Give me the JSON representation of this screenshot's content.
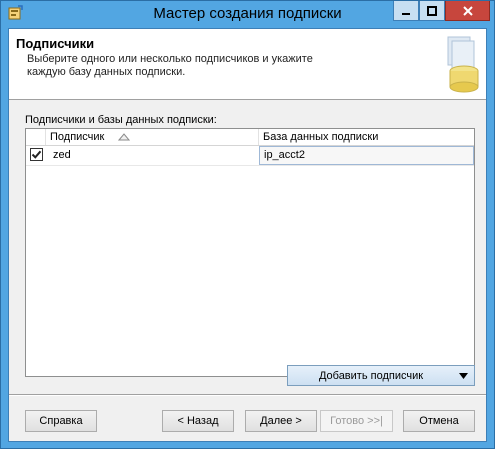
{
  "window": {
    "title": "Мастер создания подписки"
  },
  "header": {
    "title": "Подписчики",
    "description": "Выберите одного или несколько подписчиков и укажите каждую базу данных подписки."
  },
  "section_label": "Подписчики и базы данных подписки:",
  "grid": {
    "columns": [
      "Подписчик",
      "База данных подписки"
    ],
    "sort": "ascending",
    "rows": [
      {
        "checked": true,
        "subscriber": "zed",
        "database": "ip_acct2"
      }
    ]
  },
  "add_subscriber_label": "Добавить подписчик",
  "buttons": {
    "help": "Справка",
    "back": "< Назад",
    "next": "Далее >",
    "finish": "Готово >>|",
    "cancel": "Отмена"
  },
  "icons": {
    "app": "wizard-app-icon",
    "minimize": "minimize-icon",
    "maximize": "maximize-icon",
    "close": "close-icon",
    "header_graphic": "database-subscription-icon",
    "sort": "sort-ascending-icon",
    "check": "checkmark-icon",
    "dropdown": "chevron-down-icon"
  },
  "colors": {
    "title_bar": "#52a6e2",
    "close_button": "#c7463d"
  }
}
